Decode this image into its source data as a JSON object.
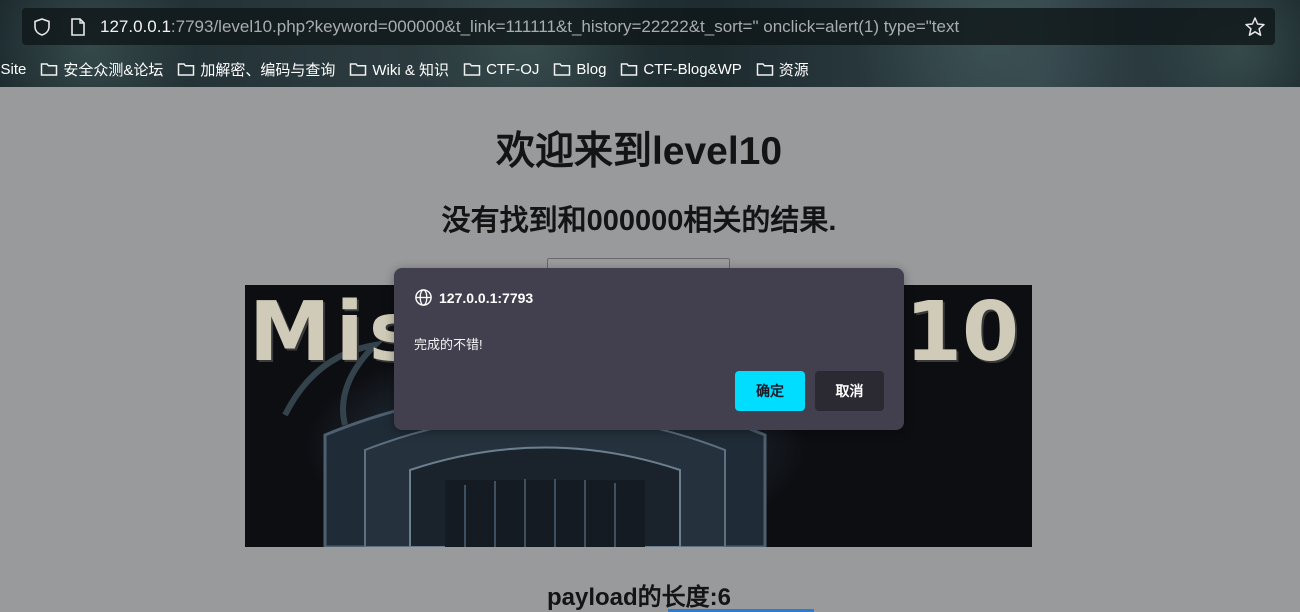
{
  "browser": {
    "url_host": "127.0.0.1",
    "url_rest": ":7793/level10.php?keyword=000000&t_link=111111&t_history=22222&t_sort=\" onclick=alert(1) type=\"text",
    "bookmarks": [
      {
        "label": "e Site",
        "icon": "none"
      },
      {
        "label": "安全众测&论坛",
        "icon": "folder-icon"
      },
      {
        "label": "加解密、编码与查询",
        "icon": "folder-icon"
      },
      {
        "label": "Wiki & 知识",
        "icon": "folder-icon"
      },
      {
        "label": "CTF-OJ",
        "icon": "folder-icon"
      },
      {
        "label": "Blog",
        "icon": "folder-icon"
      },
      {
        "label": "CTF-Blog&WP",
        "icon": "folder-icon"
      },
      {
        "label": "资源",
        "icon": "folder-icon"
      }
    ]
  },
  "page": {
    "title": "欢迎来到level10",
    "result": "没有找到和000000相关的结果.",
    "banner_text_left": "Mis",
    "banner_text_right": "10",
    "payload_length": "payload的长度:6"
  },
  "dialog": {
    "origin": "127.0.0.1:7793",
    "message": "完成的不错!",
    "ok_label": "确定",
    "cancel_label": "取消"
  },
  "colors": {
    "page_background": "#999a9c",
    "dialog_background": "#42404e",
    "ok_button": "#00ddff",
    "cancel_button": "#2b2a33"
  }
}
